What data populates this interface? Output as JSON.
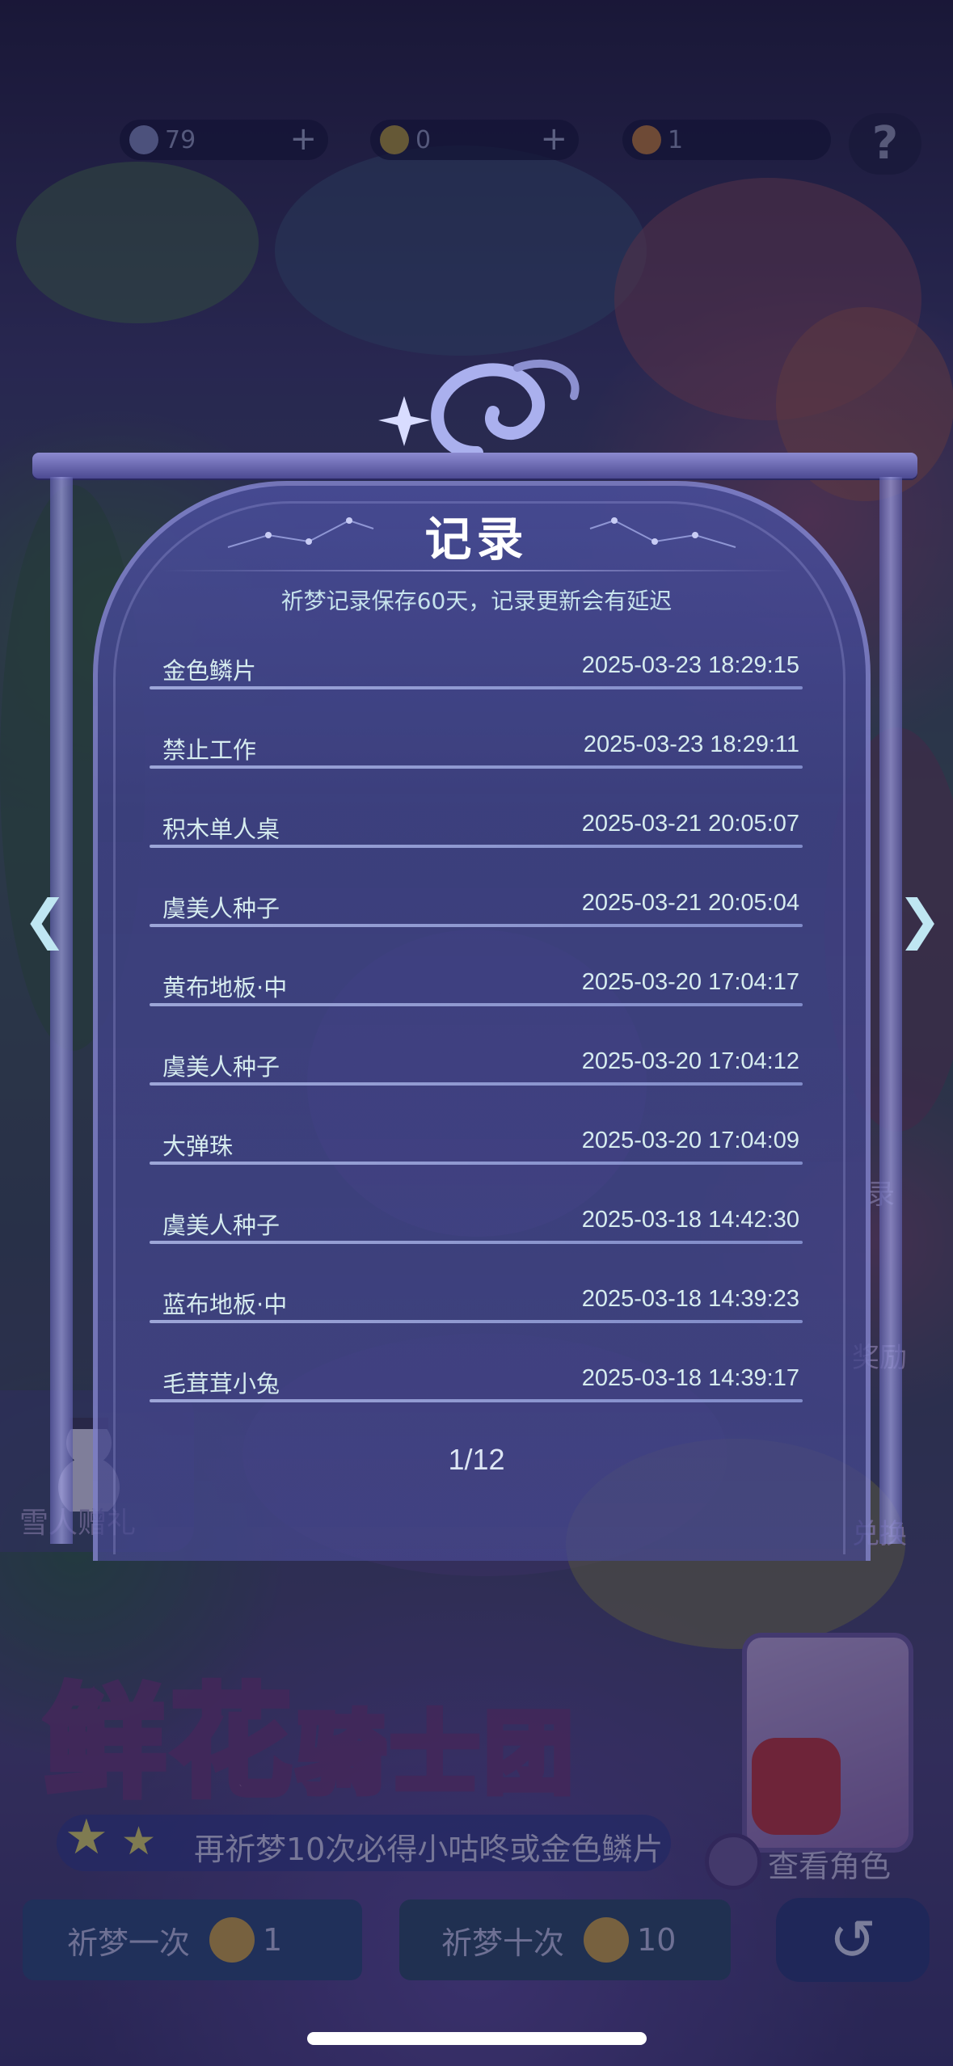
{
  "resources": [
    {
      "icon": "moon-icon",
      "value": "79",
      "add": "+"
    },
    {
      "icon": "gold-coin-icon",
      "value": "0",
      "add": "+"
    },
    {
      "icon": "orange-coin-icon",
      "value": "1"
    }
  ],
  "help_label": "?",
  "dialog": {
    "title": "记录",
    "subtitle": "祈梦记录保存60天，记录更新会有延迟",
    "records": [
      {
        "name": "金色鳞片",
        "time": "2025-03-23 18:29:15"
      },
      {
        "name": "禁止工作",
        "time": "2025-03-23 18:29:11"
      },
      {
        "name": "积木单人桌",
        "time": "2025-03-21 20:05:07"
      },
      {
        "name": "虞美人种子",
        "time": "2025-03-21 20:05:04"
      },
      {
        "name": "黄布地板·中",
        "time": "2025-03-20 17:04:17"
      },
      {
        "name": "虞美人种子",
        "time": "2025-03-20 17:04:12"
      },
      {
        "name": "大弹珠",
        "time": "2025-03-20 17:04:09"
      },
      {
        "name": "虞美人种子",
        "time": "2025-03-18 14:42:30"
      },
      {
        "name": "蓝布地板·中",
        "time": "2025-03-18 14:39:23"
      },
      {
        "name": "毛茸茸小兔",
        "time": "2025-03-18 14:39:17"
      }
    ],
    "page": "1/12",
    "prev_arrow": "❮",
    "next_arrow": "❯"
  },
  "background": {
    "side_right": [
      "录",
      "奖励",
      "兑换"
    ],
    "snowman_label": "雪人赠礼",
    "banner_title_big": "鲜花",
    "banner_title_small": "骑士团",
    "promo": "再祈梦10次必得小咕咚或金色鳞片",
    "view_role": "查看角色",
    "pray_once": {
      "label": "祈梦一次",
      "cost": "1"
    },
    "pray_ten": {
      "label": "祈梦十次",
      "cost": "10"
    },
    "back_icon": "↺"
  }
}
